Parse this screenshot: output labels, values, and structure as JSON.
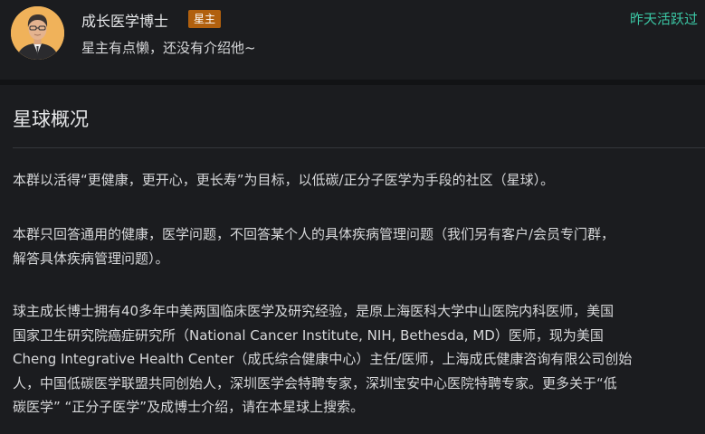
{
  "owner": {
    "name": "成长医学博士",
    "badge": "星主",
    "intro": "星主有点懒，还没有介绍他~",
    "activity": "昨天活跃过"
  },
  "overview": {
    "title": "星球概况",
    "paragraphs": [
      {
        "lines": [
          "本群以活得“更健康，更开心，更长寿”为目标，以低碳/正分子医学为手段的社区（星球）。"
        ]
      },
      {
        "lines": [
          "本群只回答通用的健康，医学问题，不回答某个人的具体疾病管理问题（我们另有客户/会员专门群，",
          "解答具体疾病管理问题）。"
        ]
      },
      {
        "lines": [
          "球主成长博士拥有40多年中美两国临床医学及研究经验，是原上海医科大学中山医院内科医师，美国",
          "国家卫生研究院癌症研究所（National Cancer Institute, NIH, Bethesda, MD）医师，现为美国",
          "Cheng Integrative Health Center（成氏综合健康中心）主任/医师，上海成氏健康咨询有限公司创始",
          "人，中国低碳医学联盟共同创始人，深圳医学会特聘专家，深圳宝安中心医院特聘专家。更多关于“低",
          "碳医学” “正分子医学”及成博士介绍，请在本星球上搜索。"
        ]
      }
    ]
  }
}
